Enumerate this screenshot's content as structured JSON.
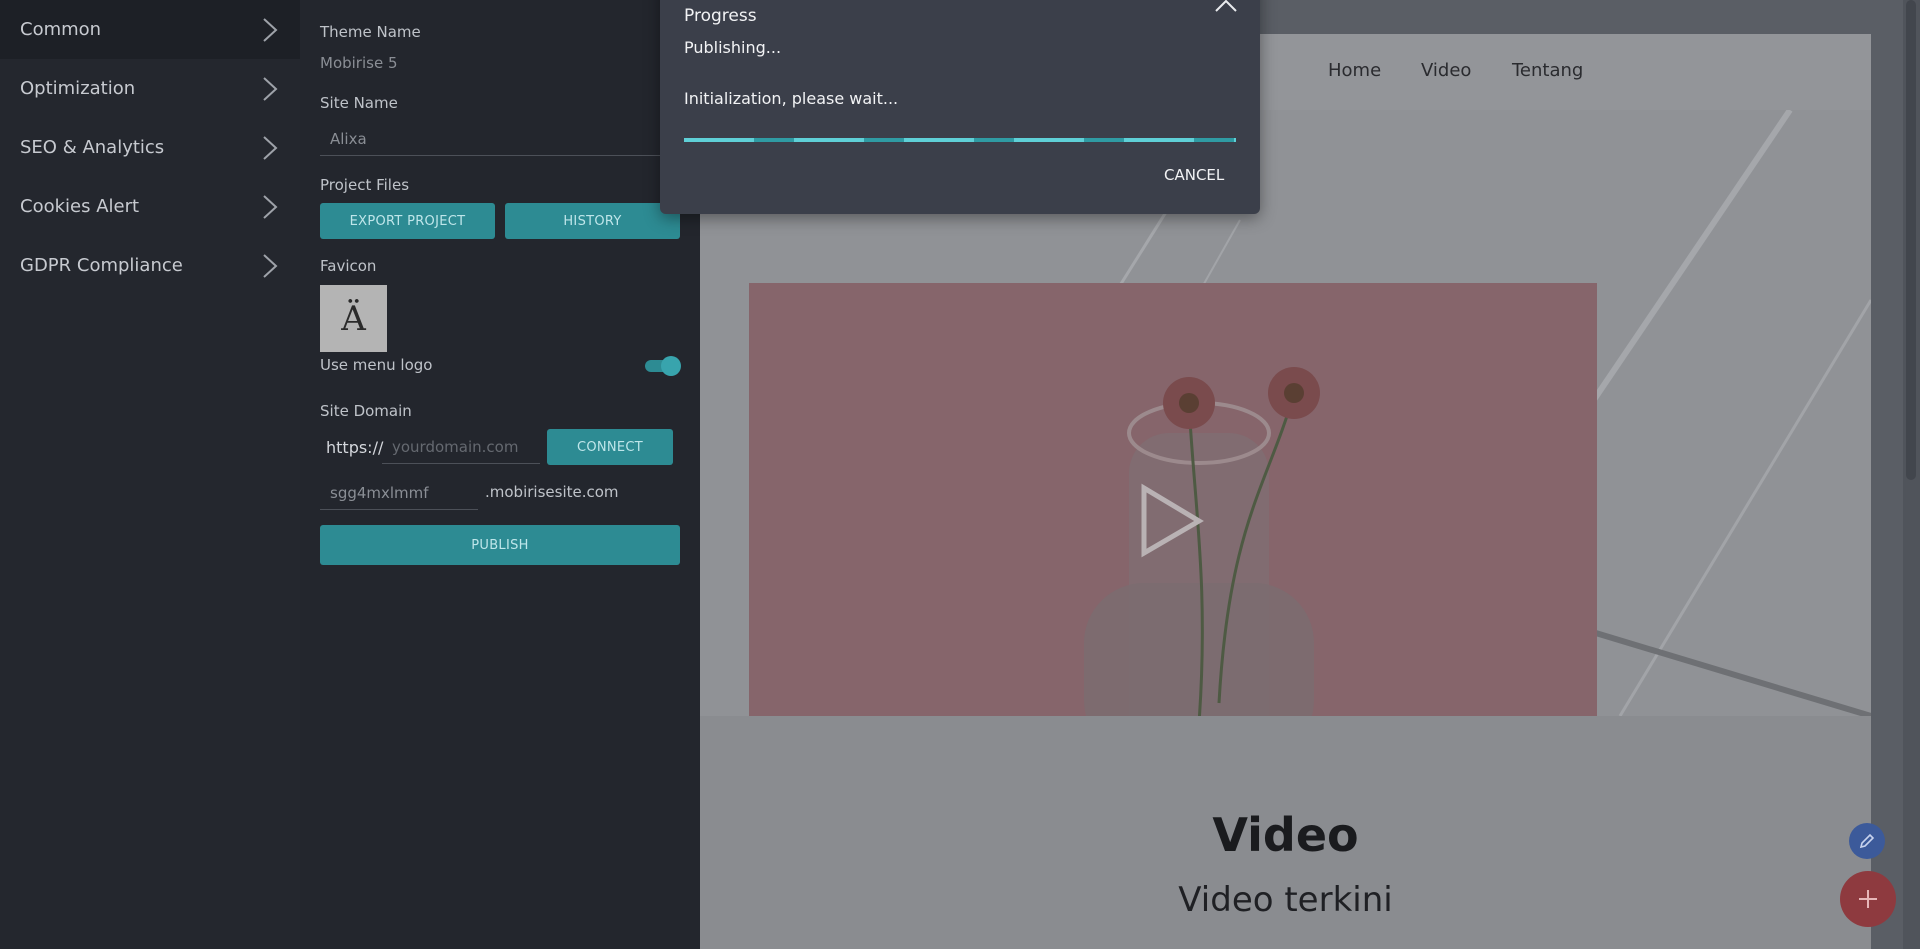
{
  "menu": {
    "items": [
      {
        "label": "Common",
        "active": true
      },
      {
        "label": "Optimization"
      },
      {
        "label": "SEO & Analytics"
      },
      {
        "label": "Cookies Alert"
      },
      {
        "label": "GDPR Compliance"
      }
    ]
  },
  "settings": {
    "theme_name_label": "Theme Name",
    "theme_name_value": "Mobirise 5",
    "site_name_label": "Site Name",
    "site_name_value": "Alixa",
    "project_files_label": "Project Files",
    "export_button": "EXPORT PROJECT",
    "history_button": "HISTORY",
    "favicon_label": "Favicon",
    "favicon_glyph": "Ä",
    "use_menu_logo_label": "Use menu logo",
    "use_menu_logo_on": true,
    "site_domain_label": "Site Domain",
    "protocol": "https://",
    "domain_placeholder": "yourdomain.com",
    "connect_button": "CONNECT",
    "subdomain_value": "sgg4mxlmmf",
    "subdomain_suffix": ".mobirisesite.com",
    "publish_button": "PUBLISH"
  },
  "preview": {
    "nav": [
      "Home",
      "Video",
      "Tentang"
    ],
    "section_title": "Video",
    "section_subtitle": "Video terkini"
  },
  "dialog": {
    "title": "Progress",
    "status": "Publishing...",
    "detail": "Initialization, please wait...",
    "cancel_label": "CANCEL"
  },
  "colors": {
    "accent": "#2d8b93",
    "progress": "#5fd0d7",
    "fab_edit": "#3c5a9a",
    "fab_add": "#8e3a3f"
  }
}
